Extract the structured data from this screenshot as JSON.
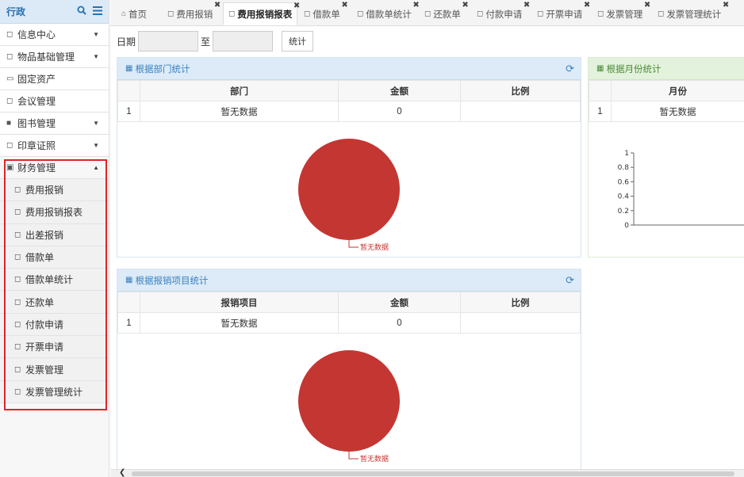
{
  "sidebar": {
    "title": "行政",
    "menu_top": [
      {
        "label": "信息中心",
        "caret": true
      },
      {
        "label": "物品基础管理",
        "caret": true
      },
      {
        "label": "固定资产",
        "caret": false
      },
      {
        "label": "会议管理",
        "caret": false
      },
      {
        "label": "图书管理",
        "caret": true
      },
      {
        "label": "印章证照",
        "caret": true
      }
    ],
    "finance": {
      "label": "财务管理"
    },
    "finance_sub": [
      "费用报销",
      "费用报销报表",
      "出差报销",
      "借款单",
      "借款单统计",
      "还款单",
      "付款申请",
      "开票申请",
      "发票管理",
      "发票管理统计"
    ]
  },
  "tabs": [
    {
      "label": "首页"
    },
    {
      "label": "费用报销"
    },
    {
      "label": "费用报销报表"
    },
    {
      "label": "借款单"
    },
    {
      "label": "借款单统计"
    },
    {
      "label": "还款单"
    },
    {
      "label": "付款申请"
    },
    {
      "label": "开票申请"
    },
    {
      "label": "发票管理"
    },
    {
      "label": "发票管理统计"
    }
  ],
  "filter": {
    "date_label": "日期",
    "to_label": "至",
    "start_value": "",
    "end_value": "",
    "stat_button": "统计"
  },
  "dept_panel": {
    "title": "根据部门统计",
    "columns": [
      "部门",
      "金额",
      "比例"
    ],
    "row": {
      "num": "1",
      "name": "暂无数据",
      "amount": "0",
      "ratio": ""
    },
    "pie_label": "暂无数据"
  },
  "month_panel": {
    "title": "根据月份统计",
    "columns": [
      "月份"
    ],
    "row": {
      "num": "1",
      "name": "暂无数据"
    },
    "y_ticks": [
      "1",
      "0.8",
      "0.6",
      "0.4",
      "0.2",
      "0"
    ]
  },
  "item_panel": {
    "title": "根据报销项目统计",
    "columns": [
      "报销项目",
      "金额",
      "比例"
    ],
    "row": {
      "num": "1",
      "name": "暂无数据",
      "amount": "0",
      "ratio": ""
    },
    "pie_label": "暂无数据"
  },
  "colors": {
    "pie": "#c43632",
    "accent": "#3a7fbf",
    "highlight": "#d9262c"
  }
}
